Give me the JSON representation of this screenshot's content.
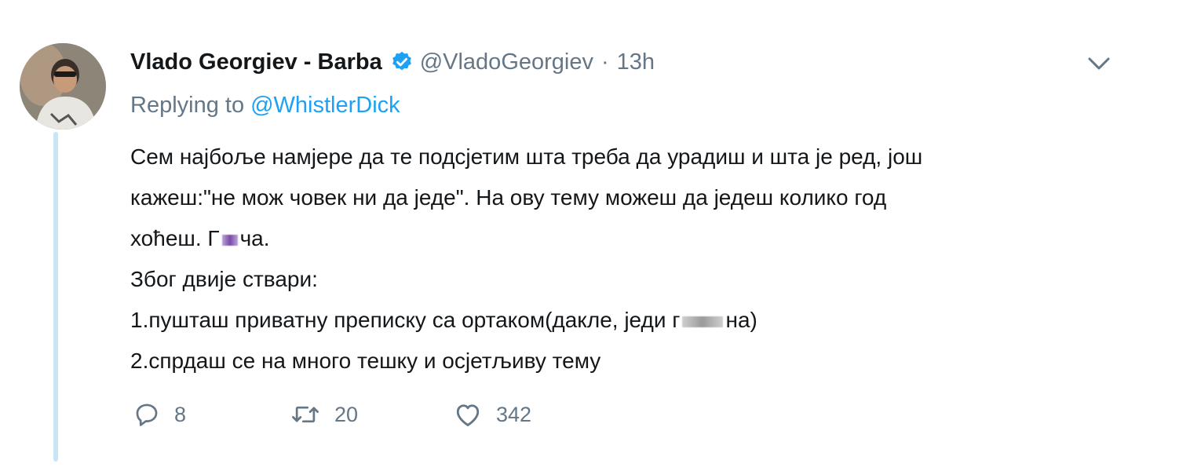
{
  "tweet": {
    "author_name": "Vlado Georgiev - Barba",
    "handle": "@VladoGeorgiev",
    "separator": "·",
    "time": "13h",
    "replying_prefix": "Replying to",
    "replying_to": "@WhistlerDick",
    "body_lines": [
      "Сем најбоље намјере да те подсјетим шта треба да урадиш и шта је ред, још",
      "кажеш:\"не мож човек ни да једе\". На ову тему можеш да једеш колико год",
      "хоћеш. Г",
      "ча.",
      "Због двије ствари:",
      "1.пушташ приватну преписку са ортаком(дакле, једи г",
      "на)",
      "2.спрдаш се на много тешку и осјетљиву тему"
    ],
    "counts": {
      "replies": "8",
      "retweets": "20",
      "likes": "342"
    },
    "icons": {
      "verified": "verified-badge-icon",
      "menu": "chevron-down-icon",
      "reply": "reply-bubble-icon",
      "retweet": "retweet-icon",
      "like": "heart-icon"
    },
    "colors": {
      "text": "#14171a",
      "secondary": "#657786",
      "accent": "#1da1f2",
      "thread_line": "#c9e4f5"
    }
  }
}
